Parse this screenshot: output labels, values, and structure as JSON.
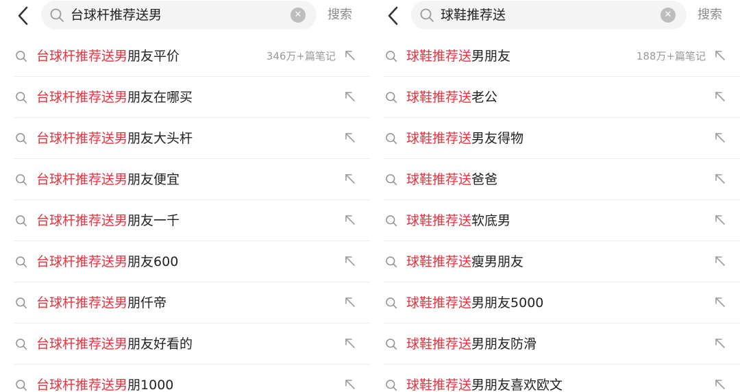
{
  "icons": {
    "back": "chevron-left-icon",
    "search": "search-icon",
    "clear": "clear-icon",
    "row_search": "search-icon",
    "fill": "arrow-up-left-icon"
  },
  "colors": {
    "highlight": "#e5343f",
    "text": "#222222",
    "muted": "#9a9a9a",
    "search_bg": "#f4f4f4"
  },
  "left": {
    "query": "台球杆推荐送男",
    "clear_symbol": "✕",
    "search_label": "搜索",
    "suggestions": [
      {
        "match": "台球杆推荐送男",
        "rest": "朋友平价",
        "meta": "346万+篇笔记"
      },
      {
        "match": "台球杆推荐送男",
        "rest": "朋友在哪买"
      },
      {
        "match": "台球杆推荐送男",
        "rest": "朋友大头杆"
      },
      {
        "match": "台球杆推荐送男",
        "rest": "朋友便宜"
      },
      {
        "match": "台球杆推荐送男",
        "rest": "朋友一千"
      },
      {
        "match": "台球杆推荐送男",
        "rest": "朋友600"
      },
      {
        "match": "台球杆推荐送男",
        "rest": "朋仟帝"
      },
      {
        "match": "台球杆推荐送男",
        "rest": "朋友好看的"
      },
      {
        "match": "台球杆推荐送男",
        "rest": "朋1000"
      }
    ]
  },
  "right": {
    "query": "球鞋推荐送",
    "clear_symbol": "✕",
    "search_label": "搜索",
    "suggestions": [
      {
        "match": "球鞋推荐送",
        "rest": "男朋友",
        "meta": "188万+篇笔记"
      },
      {
        "match": "球鞋推荐送",
        "rest": "老公"
      },
      {
        "match": "球鞋推荐送",
        "rest": "男友得物"
      },
      {
        "match": "球鞋推荐送",
        "rest": "爸爸"
      },
      {
        "match": "球鞋推荐送",
        "rest": "软底男"
      },
      {
        "match": "球鞋推荐送",
        "rest": "瘦男朋友"
      },
      {
        "match": "球鞋推荐送",
        "rest": "男朋友5000"
      },
      {
        "match": "球鞋推荐送",
        "rest": "男朋友防滑"
      },
      {
        "match": "球鞋推荐送",
        "rest": "男朋友喜欢欧文"
      }
    ]
  }
}
